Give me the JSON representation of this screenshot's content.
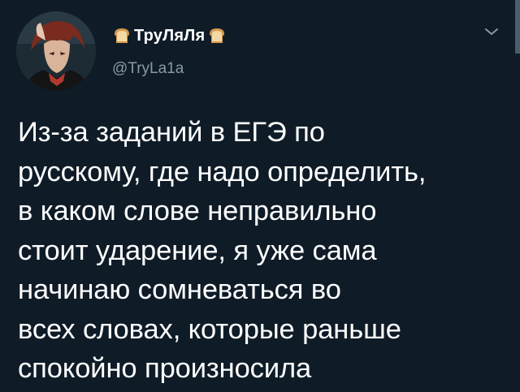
{
  "author": {
    "display_name": "ТруЛяЛя",
    "handle": "@TryLa1a",
    "avatar_icon": "anime-avatar",
    "name_emoji": "bread-icon"
  },
  "tweet": {
    "text": "Из-за заданий в ЕГЭ по\nрусскому, где надо определить,\nв каком слове неправильно\nстоит ударение, я уже сама\nначинаю сомневаться во\nвсех словах, которые раньше\nспокойно произносила"
  },
  "menu": {
    "icon": "chevron-down-icon"
  },
  "colors": {
    "background": "#0f1c28",
    "text": "#ffffff",
    "secondary_text": "#8899a6"
  }
}
